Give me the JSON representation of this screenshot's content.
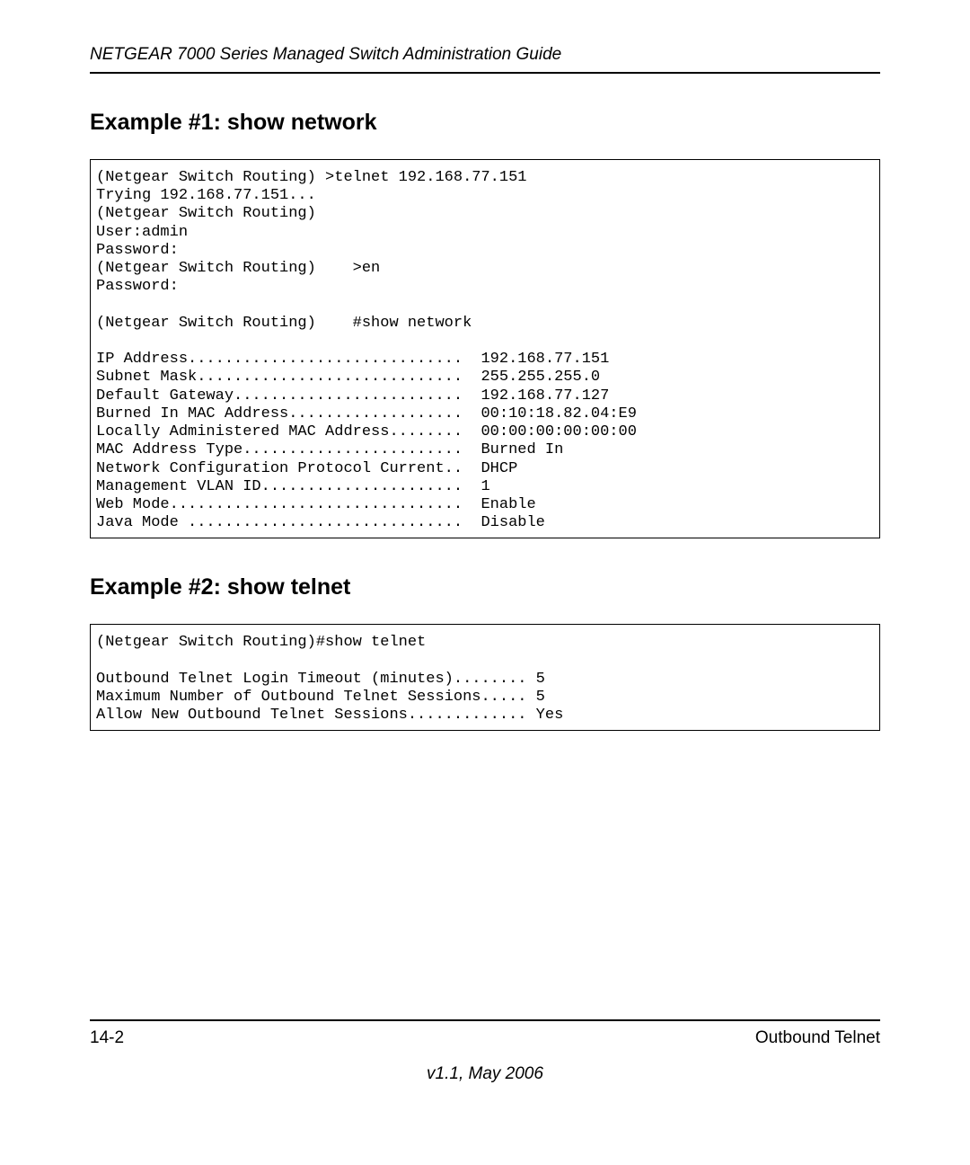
{
  "header": {
    "title": "NETGEAR 7000  Series Managed Switch Administration Guide"
  },
  "sections": {
    "example1": {
      "heading": "Example #1: show network",
      "code": "(Netgear Switch Routing) >telnet 192.168.77.151\nTrying 192.168.77.151...\n(Netgear Switch Routing)\nUser:admin\nPassword:\n(Netgear Switch Routing)    >en\nPassword:\n\n(Netgear Switch Routing)    #show network\n\nIP Address..............................  192.168.77.151\nSubnet Mask.............................  255.255.255.0\nDefault Gateway.........................  192.168.77.127\nBurned In MAC Address...................  00:10:18.82.04:E9\nLocally Administered MAC Address........  00:00:00:00:00:00\nMAC Address Type........................  Burned In\nNetwork Configuration Protocol Current..  DHCP\nManagement VLAN ID......................  1\nWeb Mode................................  Enable\nJava Mode ..............................  Disable"
    },
    "example2": {
      "heading": "Example #2: show telnet",
      "code": "(Netgear Switch Routing)#show telnet\n\nOutbound Telnet Login Timeout (minutes)........ 5\nMaximum Number of Outbound Telnet Sessions..... 5\nAllow New Outbound Telnet Sessions............. Yes"
    }
  },
  "footer": {
    "page_num": "14-2",
    "section_name": "Outbound Telnet",
    "version": "v1.1, May 2006"
  }
}
